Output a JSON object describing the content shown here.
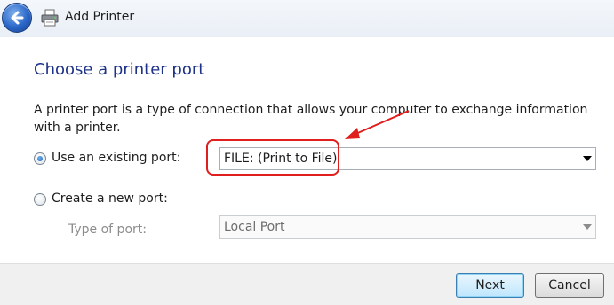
{
  "window": {
    "title": "Add Printer"
  },
  "page": {
    "heading": "Choose a printer port",
    "description": "A printer port is a type of connection that allows your computer to exchange information with a printer."
  },
  "existing_port": {
    "label": "Use an existing port:",
    "selected": true,
    "value": "FILE: (Print to File)"
  },
  "new_port": {
    "label": "Create a new port:",
    "selected": false,
    "type_label": "Type of port:",
    "type_value": "Local Port"
  },
  "buttons": {
    "next": "Next",
    "cancel": "Cancel"
  },
  "colors": {
    "annotation": "#e01e1e",
    "heading": "#1e3287"
  }
}
